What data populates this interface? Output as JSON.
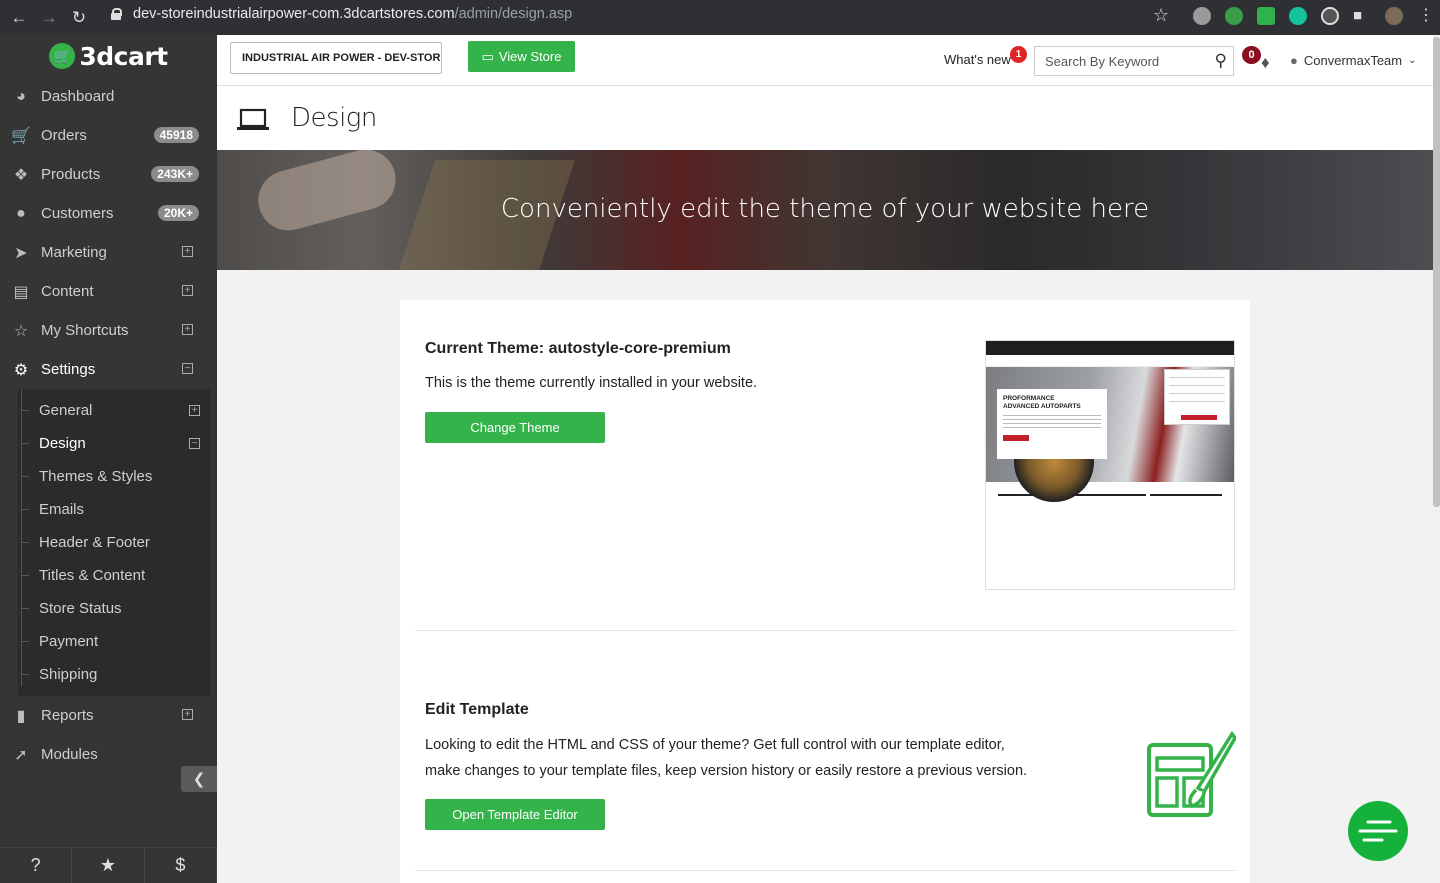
{
  "browser": {
    "url_host": "dev-storeindustrialairpower-com.3dcartstores.com",
    "url_path": "/admin/design.asp"
  },
  "sidebar": {
    "logo": "3dcart",
    "items": [
      {
        "label": "Dashboard",
        "icon": "dashboard-icon",
        "badge": ""
      },
      {
        "label": "Orders",
        "icon": "cart-icon",
        "badge": "45918"
      },
      {
        "label": "Products",
        "icon": "tags-icon",
        "badge": "243K+"
      },
      {
        "label": "Customers",
        "icon": "user-icon",
        "badge": "20K+"
      },
      {
        "label": "Marketing",
        "icon": "megaphone-icon",
        "badge": ""
      },
      {
        "label": "Content",
        "icon": "document-icon",
        "badge": ""
      },
      {
        "label": "My Shortcuts",
        "icon": "star-icon",
        "badge": ""
      },
      {
        "label": "Settings",
        "icon": "gears-icon",
        "badge": ""
      }
    ],
    "settings_sub": [
      "General",
      "Design",
      "Themes & Styles",
      "Emails",
      "Header & Footer",
      "Titles & Content",
      "Store Status",
      "Payment",
      "Shipping"
    ],
    "bottom_items": [
      {
        "label": "Reports",
        "icon": "bar-chart-icon"
      },
      {
        "label": "Modules",
        "icon": "rocket-icon"
      }
    ]
  },
  "topbar": {
    "store_name": "INDUSTRIAL AIR POWER - DEV-STOREIND",
    "view_store": "View Store",
    "whats_new": "What's new",
    "whats_new_count": "1",
    "search_placeholder": "Search By Keyword",
    "notifications": "0",
    "user": "ConvermaxTeam"
  },
  "page": {
    "title": "Design",
    "banner": "Conveniently edit the theme of your website here"
  },
  "theme_section": {
    "title": "Current Theme: autostyle-core-premium",
    "description": "This is the theme currently installed in your website.",
    "button": "Change Theme",
    "preview_heading_1": "PROFORMANCE",
    "preview_heading_2": "ADVANCED AUTOPARTS"
  },
  "template_section": {
    "title": "Edit Template",
    "description_line1": "Looking to edit the HTML and CSS of your theme? Get full control with our template editor,",
    "description_line2": "make changes to your template files, keep version history or easily restore a previous version.",
    "button": "Open Template Editor"
  },
  "colors": {
    "sidebar_bg": "#353535",
    "accent_green": "#33b34a",
    "badge_red": "#e02424"
  }
}
